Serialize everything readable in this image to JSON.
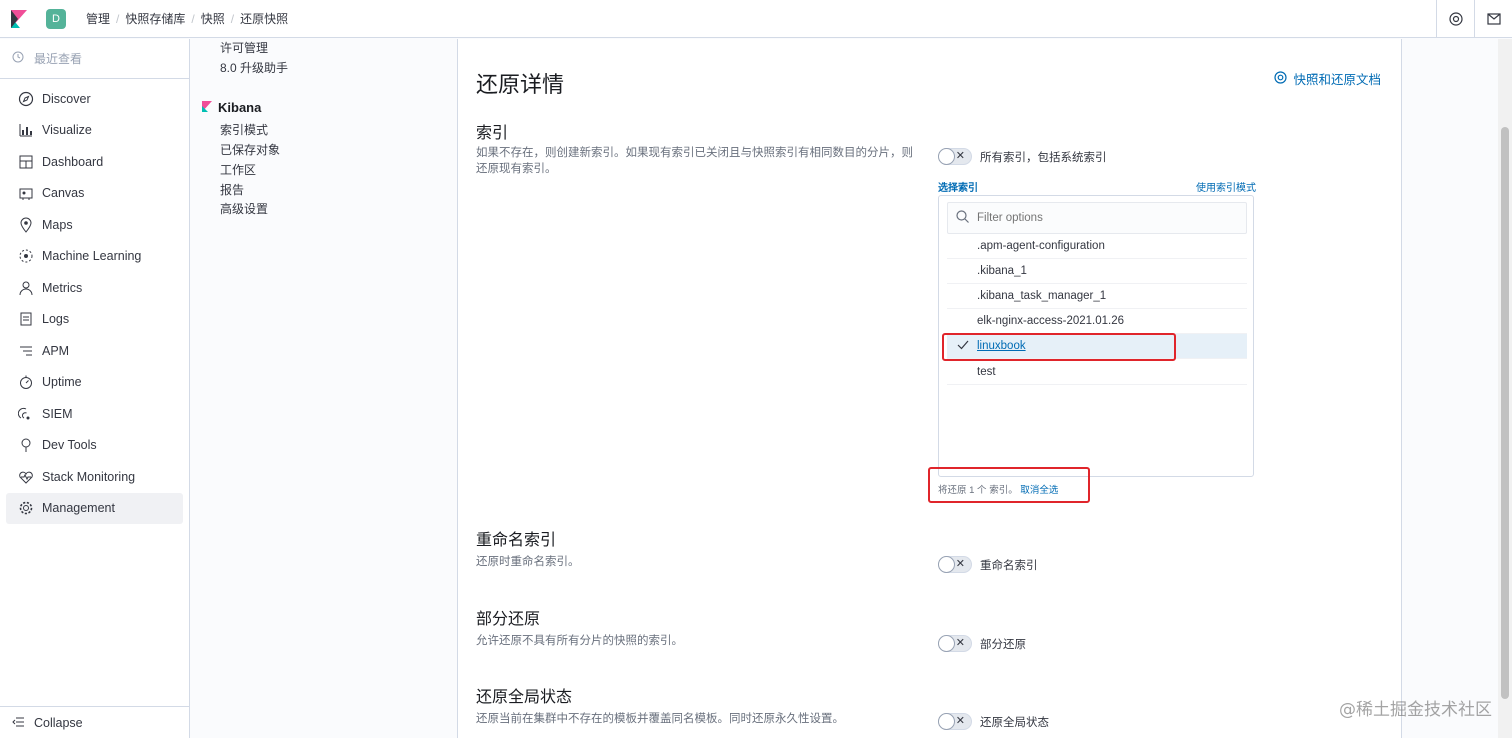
{
  "header": {
    "space_initial": "D",
    "breadcrumbs": [
      "管理",
      "快照存储库",
      "快照",
      "还原快照"
    ]
  },
  "nav": {
    "recent_label": "最近查看",
    "items": [
      {
        "label": "Discover",
        "icon": "compass-icon"
      },
      {
        "label": "Visualize",
        "icon": "visualize-icon"
      },
      {
        "label": "Dashboard",
        "icon": "dashboard-icon"
      },
      {
        "label": "Canvas",
        "icon": "canvas-icon"
      },
      {
        "label": "Maps",
        "icon": "maps-icon"
      },
      {
        "label": "Machine Learning",
        "icon": "machine-learning-icon"
      },
      {
        "label": "Metrics",
        "icon": "metrics-icon"
      },
      {
        "label": "Logs",
        "icon": "logs-icon"
      },
      {
        "label": "APM",
        "icon": "apm-icon"
      },
      {
        "label": "Uptime",
        "icon": "uptime-icon"
      },
      {
        "label": "SIEM",
        "icon": "siem-icon"
      },
      {
        "label": "Dev Tools",
        "icon": "dev-tools-icon"
      },
      {
        "label": "Stack Monitoring",
        "icon": "stack-monitoring-icon"
      },
      {
        "label": "Management",
        "icon": "gear-icon"
      }
    ],
    "collapse_label": "Collapse"
  },
  "mgmt": {
    "top_items": [
      "许可管理",
      "8.0 升级助手"
    ],
    "kibana_title": "Kibana",
    "kibana_items": [
      "索引模式",
      "已保存对象",
      "工作区",
      "报告",
      "高级设置"
    ]
  },
  "main": {
    "title": "还原详情",
    "doc_link": "快照和还原文档",
    "indices": {
      "title": "索引",
      "desc": "如果不存在，则创建新索引。如果现有索引已关闭且与快照索引有相同数目的分片，则还原现有索引。",
      "switch_label": "所有索引，包括系统索引",
      "select_label": "选择索引",
      "mode_label": "使用索引模式",
      "filter_placeholder": "Filter options",
      "options": [
        ".apm-agent-configuration",
        ".kibana_1",
        ".kibana_task_manager_1",
        "elk-nginx-access-2021.01.26",
        "linuxbook",
        "test"
      ],
      "selected": "linuxbook",
      "restore_count_text": "将还原 1 个 索引。",
      "deselect_all": "取消全选"
    },
    "rename": {
      "title": "重命名索引",
      "desc": "还原时重命名索引。",
      "switch_label": "重命名索引"
    },
    "partial": {
      "title": "部分还原",
      "desc": "允许还原不具有所有分片的快照的索引。",
      "switch_label": "部分还原"
    },
    "global_state": {
      "title": "还原全局状态",
      "desc": "还原当前在集群中不存在的模板并覆盖同名模板。同时还原永久性设置。",
      "switch_label": "还原全局状态"
    }
  },
  "watermark": "@稀土掘金技术社区",
  "colors": {
    "accent": "#006bb4",
    "highlight": "#e0252b",
    "space": "#54b399"
  }
}
